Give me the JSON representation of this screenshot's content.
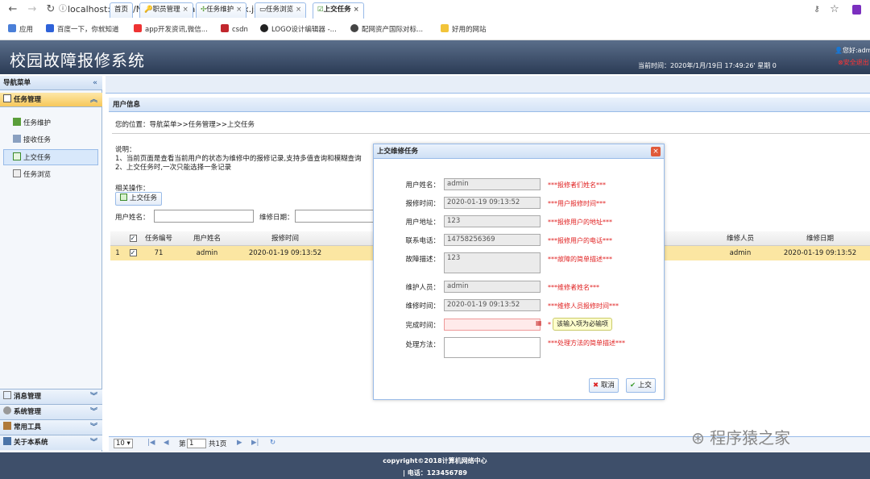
{
  "browser": {
    "url": "localhost:8080/NetworkRepairsSys/index.jsp#",
    "bookmarks": [
      "应用",
      "百度一下，你就知道",
      "app开发资讯,微信...",
      "csdn",
      "LOGO设计编辑器 -...",
      "配网资产国际对标...",
      "好用的网站"
    ]
  },
  "header": {
    "title": "校园故障报修系统",
    "time": "当前时间：2020年/1月/19日   17:49:26'   星期 0",
    "greeting": "您好:admi",
    "logout": "安全退出"
  },
  "sidebar": {
    "title": "导航菜单",
    "group": "任务管理",
    "items": [
      "任务维护",
      "接收任务",
      "上交任务",
      "任务浏览"
    ],
    "accordions": [
      "消息管理",
      "系统管理",
      "常用工具",
      "关于本系统"
    ]
  },
  "tabs": [
    "首页",
    "职员管理",
    "任务维护",
    "任务浏览",
    "上交任务"
  ],
  "panel": {
    "title": "用户信息",
    "breadcrumb": "您的位置：导航菜单>>任务管理>>上交任务",
    "note_title": "说明：",
    "note1": "1、当前页面是查看当前用户的状态为维修中的报修记录,支持多值查询和模糊查询",
    "note2": "2、上交任务时,一次只能选择一条记录",
    "ops_label": "相关操作：",
    "submit_label": "上交任务",
    "search_user_label": "用户姓名：",
    "search_date_label": "维修日期："
  },
  "grid": {
    "headers": [
      "任务编号",
      "用户姓名",
      "报修时间",
      "维修人员",
      "维修日期"
    ],
    "row": {
      "index": "1",
      "id": "71",
      "user": "admin",
      "time": "2020-01-19 09:13:52",
      "repairer": "admin",
      "date": "2020-01-19 09:13:52"
    }
  },
  "pager": {
    "size": "10 ▾",
    "page_label": "第",
    "page": "1",
    "total": "共1页"
  },
  "footer": {
    "copyright": "copyright©2018计算机网络中心",
    "phone": "| 电话：123456789"
  },
  "dialog": {
    "title": "上交维修任务",
    "fields": [
      {
        "label": "用户姓名：",
        "value": "admin",
        "hint": "***报修者们姓名***"
      },
      {
        "label": "报修时间：",
        "value": "2020-01-19 09:13:52",
        "hint": "***用户报修时间***"
      },
      {
        "label": "用户地址：",
        "value": "123",
        "hint": "***报修用户的地址***"
      },
      {
        "label": "联系电话：",
        "value": "14758256369",
        "hint": "***报修用户的电话***"
      },
      {
        "label": "故障描述：",
        "value": "123",
        "hint": "***故障的简单描述***"
      },
      {
        "label": "维护人员：",
        "value": "admin",
        "hint": "***维修者姓名***"
      },
      {
        "label": "维修时间：",
        "value": "2020-01-19 09:13:52",
        "hint": "***维修人员报修时间***"
      },
      {
        "label": "完成时间：",
        "value": "",
        "hint": "*"
      },
      {
        "label": "处理方法：",
        "value": "",
        "hint": "***处理方法的简单描述***"
      }
    ],
    "tooltip": "该输入项为必输项",
    "cancel": "取消",
    "submit": "上交"
  },
  "watermark": "程序猿之家"
}
